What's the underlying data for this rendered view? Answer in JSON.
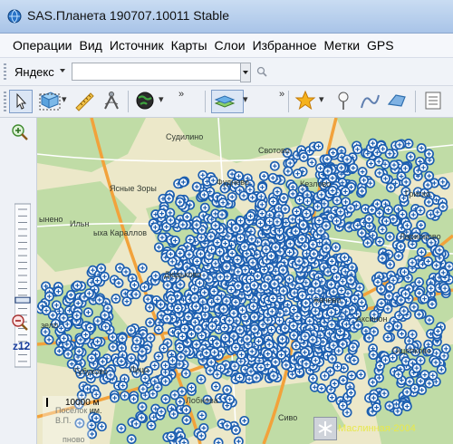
{
  "window": {
    "title": "SAS.Планета 190707.10011 Stable"
  },
  "menu": {
    "items": [
      "Операции",
      "Вид",
      "Источник",
      "Карты",
      "Слои",
      "Избранное",
      "Метки",
      "GPS"
    ]
  },
  "search": {
    "engine": "Яндекс",
    "value": "",
    "placeholder": ""
  },
  "zoom": {
    "level_label": "z12",
    "slider_level": 0.41
  },
  "map": {
    "labels": [
      "Судилино",
      "Свотово",
      "Ясные Зоры",
      "Фуднево",
      "Кезлово",
      "Гриско",
      "Ларионово",
      "ынено",
      "Ильн",
      "ыха Караллов",
      "Дюдьково",
      "жачево",
      "Аксинон",
      "зело",
      "Ощепково",
      "Тубуково",
      "Лицо",
      "Лобнова",
      "Посёлок им. В.П.",
      "Сиво",
      "пново"
    ],
    "scale_text": "10000 м",
    "layer_name": "Маслинная-2004"
  },
  "colors": {
    "marker_blue": "#1d5fb0",
    "map_green": "#b9d9a0",
    "map_beige": "#ece8c9",
    "road_orange": "#f2a23b"
  }
}
